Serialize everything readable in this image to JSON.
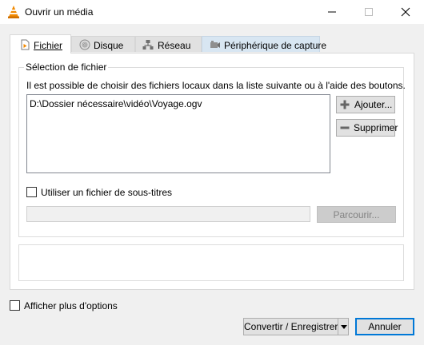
{
  "window": {
    "title": "Ouvrir un média",
    "controls": [
      "minimize-icon",
      "maximize-icon",
      "close-icon"
    ]
  },
  "tabs": [
    {
      "label": "Fichier",
      "icon": "file-icon",
      "active": true
    },
    {
      "label": "Disque",
      "icon": "disc-icon",
      "active": false
    },
    {
      "label": "Réseau",
      "icon": "network-icon",
      "active": false
    },
    {
      "label": "Périphérique de capture",
      "icon": "capture-device-icon",
      "active": false
    }
  ],
  "file_selection": {
    "legend": "Sélection de fichier",
    "description": "Il est possible de choisir des fichiers locaux dans la liste suivante ou à l'aide des boutons.",
    "files": [
      "D:\\Dossier nécessaire\\vidéo\\Voyage.ogv"
    ],
    "add_label": "Ajouter...",
    "remove_label": "Supprimer"
  },
  "subtitles": {
    "checkbox_label": "Utiliser un fichier de sous-titres",
    "checked": false,
    "path_value": "",
    "browse_label": "Parcourir..."
  },
  "footer": {
    "more_options_label": "Afficher plus d'options",
    "more_options_checked": false,
    "convert_label": "Convertir / Enregistrer",
    "cancel_label": "Annuler"
  },
  "colors": {
    "accent": "#0078d7",
    "vlc_orange": "#f28a00",
    "window_bg": "#f0f0f0"
  }
}
